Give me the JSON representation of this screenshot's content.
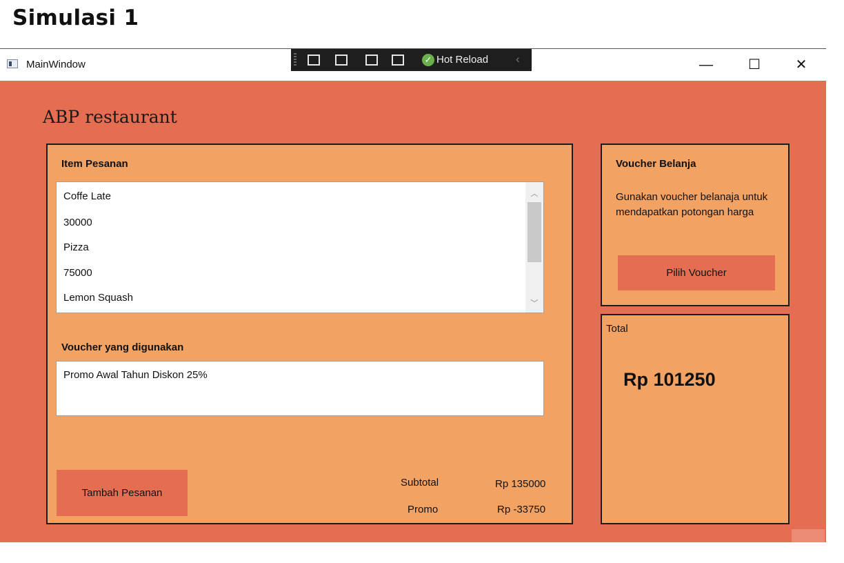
{
  "slide_title": "Simulasi 1",
  "window": {
    "title": "MainWindow",
    "minimize": "—",
    "maximize": "☐",
    "close": "✕"
  },
  "devtools": {
    "hot_reload": "Hot Reload"
  },
  "app": {
    "heading": "ABP restaurant"
  },
  "order_panel": {
    "items_label": "Item Pesanan",
    "items": [
      "Coffe Late",
      "30000",
      "Pizza",
      "75000",
      "Lemon Squash"
    ],
    "voucher_used_label": "Voucher yang digunakan",
    "voucher_used_value": "Promo Awal Tahun Diskon 25%",
    "add_button": "Tambah Pesanan",
    "subtotal_label": "Subtotal",
    "subtotal_value": "Rp 135000",
    "promo_label": "Promo",
    "promo_value": "Rp -33750"
  },
  "voucher_panel": {
    "title": "Voucher Belanja",
    "description": "Gunakan voucher belanaja untuk mendapatkan potongan harga",
    "button": "Pilih Voucher"
  },
  "total_panel": {
    "label": "Total",
    "value": "Rp 101250"
  },
  "colors": {
    "background": "#e56d51",
    "panel": "#f2a262",
    "border": "#1b1b1b"
  }
}
